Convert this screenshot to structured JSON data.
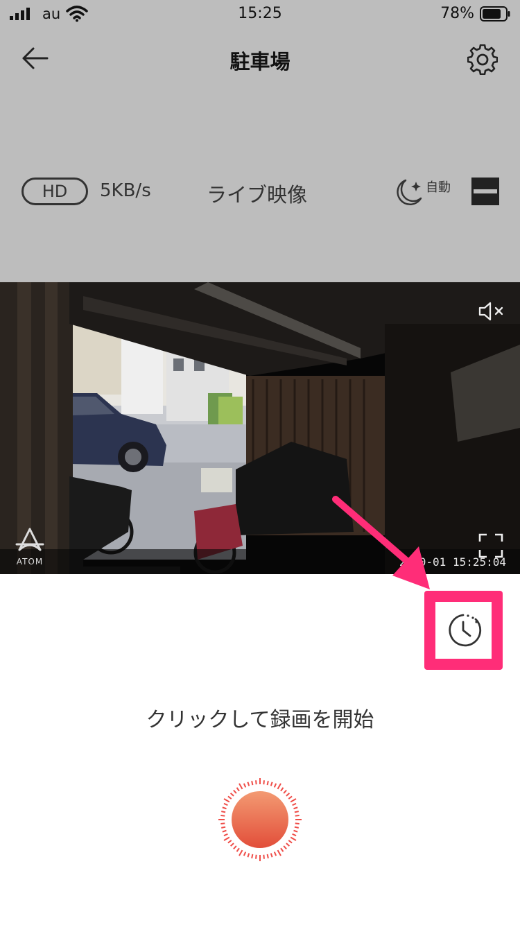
{
  "status_bar": {
    "carrier": "au",
    "time": "15:25",
    "battery_percent": "78%",
    "battery_level": 0.78
  },
  "nav": {
    "title": "駐車場",
    "back_icon": "arrow-left-icon",
    "settings_icon": "gear-icon"
  },
  "info_row": {
    "quality": "HD",
    "speed": "5KB/s",
    "live_label": "ライブ映像",
    "night_mode_icon": "moon-sparkle-icon",
    "night_mode_label": "自動",
    "layout_icon": "split-view-icon"
  },
  "video": {
    "mute_icon": "speaker-muted-icon",
    "logo_text": "ATOM",
    "fullscreen_icon": "fullscreen-icon",
    "timestamp": "2 10-01 15:25:04"
  },
  "controls": {
    "history_icon": "clock-history-icon",
    "record_hint": "クリックして録画を開始",
    "record_icon": "record-button-icon"
  },
  "colors": {
    "top_background": "#bdbdbd",
    "highlight": "#ff2d78",
    "record_orange": "#ec6a4a"
  }
}
